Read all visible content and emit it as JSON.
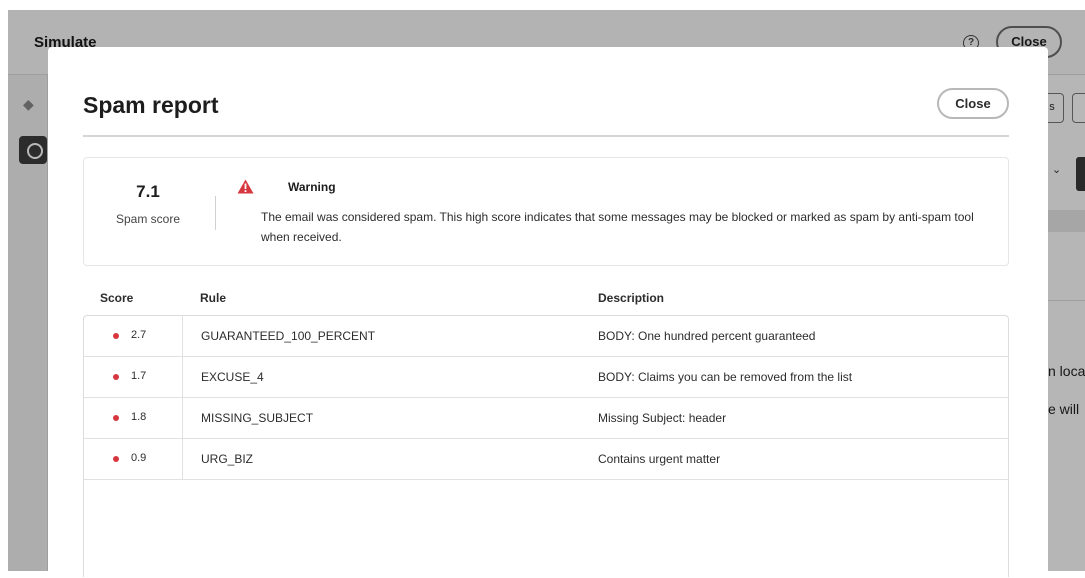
{
  "background_app": {
    "title": "Simulate",
    "help_icon": "question-circle-icon",
    "close_label": "Close",
    "partial_texts": [
      "n loca",
      "e will"
    ],
    "partial_button": "s"
  },
  "modal": {
    "title": "Spam report",
    "close_label": "Close",
    "summary": {
      "score": "7.1",
      "score_label": "Spam score",
      "warning_icon": "alert-triangle-icon",
      "warning_title": "Warning",
      "warning_text": "The email was considered spam. This high score indicates that some messages may be blocked or marked as spam by anti-spam tool when received."
    },
    "table": {
      "columns": [
        "Score",
        "Rule",
        "Description"
      ],
      "rows": [
        {
          "score": "2.7",
          "rule": "GUARANTEED_100_PERCENT",
          "description": "BODY: One hundred percent guaranteed"
        },
        {
          "score": "1.7",
          "rule": "EXCUSE_4",
          "description": "BODY: Claims you can be removed from the list"
        },
        {
          "score": "1.8",
          "rule": "MISSING_SUBJECT",
          "description": "Missing Subject: header"
        },
        {
          "score": "0.9",
          "rule": "URG_BIZ",
          "description": "Contains urgent matter"
        }
      ]
    }
  },
  "colors": {
    "warning": "#d7373f",
    "overlay": "rgba(0,0,0,0.28)"
  }
}
